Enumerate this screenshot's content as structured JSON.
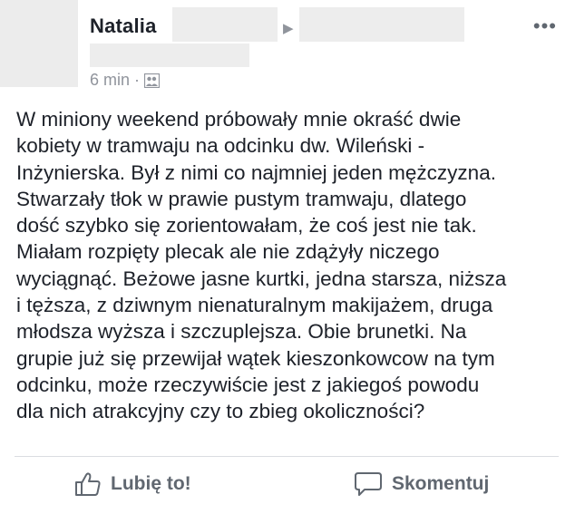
{
  "post": {
    "author": "Natalia",
    "time": "6 min",
    "separator": "·",
    "more_label": "•••",
    "arrow": "▶",
    "audience_icon": "group-icon",
    "body": "W miniony weekend próbowały mnie okraść dwie\nkobiety w tramwaju na odcinku dw. Wileński -\nInżynierska. Był z nimi co najmniej jeden mężczyzna.\nStwarzały tłok w prawie pustym tramwaju, dlatego\ndość szybko się zorientowałam, że coś jest nie tak.\nMiałam rozpięty plecak ale nie zdążyły niczego\nwyciągnąć. Beżowe jasne kurtki, jedna starsza, niższa\ni tęższa, z dziwnym nienaturalnym makijażem, druga\nmłodsza wyższa i szczuplejsza. Obie brunetki. Na\ngrupie już się przewijał wątek kieszonkowcow na tym\nodcinku, może rzeczywiście jest z jakiegoś powodu\ndla nich atrakcyjny czy to zbieg okoliczności?"
  },
  "actions": {
    "like_label": "Lubię to!",
    "comment_label": "Skomentuj"
  },
  "colors": {
    "text": "#1d2129",
    "muted": "#606770",
    "meta": "#90949c",
    "redaction": "#ededed"
  }
}
